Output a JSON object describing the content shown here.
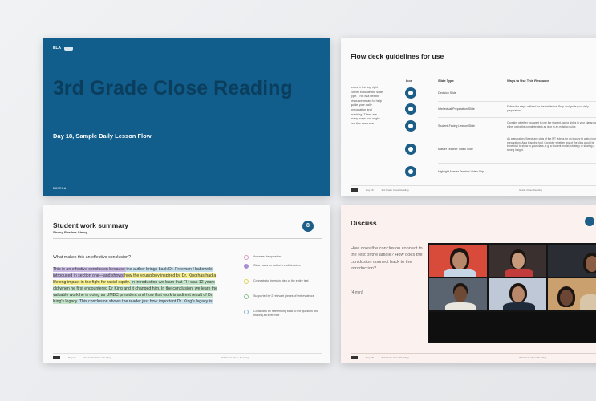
{
  "slide1": {
    "logo_text": "ELA",
    "title": "3rd Grade Close Reading",
    "subtitle": "Day 18, Sample Daily Lesson Flow",
    "footer": "EUREKA"
  },
  "slide2": {
    "title": "Flow deck guidelines for use",
    "intro": "Icons in the top right corner indicate the slide type. This is a flexible resource meant to help guide your daily preparation and teaching. There are many ways you might use this resource.",
    "headers": {
      "icon": "Icon",
      "slide_type": "Slide Type",
      "ways": "Ways to Use This Resource"
    },
    "rows": [
      {
        "type": "Decision Slide",
        "use": ""
      },
      {
        "type": "Intellectual Preparation Slide",
        "use": "Follow the steps outlined for the Intellectual Prep and guide your daily preparation."
      },
      {
        "type": "Student-Facing Lesson Slide",
        "use": "Consider whether you want to use the student-facing slides in your classroom, either using the complete deck as is or in an existing guide."
      },
      {
        "type": "Master Teacher Video Slide",
        "use": "As preparation: Select any clips of the MT videos for an inquiry to watch in your preparation. As a teaching tool: Consider whether any of the clips would be beneficial to show to your class, e.g. a student model, strategy or sharing a strong insight."
      },
      {
        "type": "Highlight Master Teacher Video Clip",
        "use": ""
      }
    ],
    "footer": {
      "a": "Day 18",
      "b": "3rd Grade Close Reading",
      "c": "Grade Close Reading"
    }
  },
  "slide3": {
    "title": "Student work summary",
    "subtitle": "Strong Readers Stamp",
    "badge": "8",
    "question": "What makes this an effective conclusion?",
    "essay": [
      {
        "text": "This is an effective conclusion because ",
        "hl": "purple"
      },
      {
        "text": "the author brings back Dr. Freeman Hrabowski",
        "hl": "blue"
      },
      {
        "text": " introduced in section one—and shows ",
        "hl": "purple"
      },
      {
        "text": "how the young boy inspired by Dr. King has had a lifelong impact in the fight for racial equity.",
        "hl": "yellow"
      },
      {
        "text": " In introduction we learn that FH was 12 years old when he first encountered Dr King and it changed him. In the conclusion, we learn the valuable work he is doing as UMBC president and how that work is a direct result of Dr. King's legacy.",
        "hl": "green"
      },
      {
        "text": " This conclusion shows the reader just how important Dr. King's legacy is.",
        "hl": "blue"
      }
    ],
    "criteria": [
      {
        "label": "Answers the question",
        "color": "#d69ac1"
      },
      {
        "label": "Clear focus on author's end/structure",
        "color": "#a98fd2"
      },
      {
        "label": "Connects to the main idea of the entire text",
        "color": "#e3cf45"
      },
      {
        "label": "Supported by 2 relevant pieces of text evidence",
        "color": "#86c08c"
      },
      {
        "label": "Concludes by referencing back to the question and making an inference",
        "color": "#86b9d2"
      }
    ],
    "footer": {
      "a": "Day 18",
      "b": "3rd Grade Close Reading",
      "c": "3rd Grade Close Reading"
    }
  },
  "slide4": {
    "title": "Discuss",
    "prompt": "How does the conclusion connect to the rest of the article? How does the conclusion connect back to the introduction?",
    "minutes": "(4 min)",
    "footer": {
      "a": "Day 18",
      "b": "3rd Grade Close Reading",
      "c": "3rd Grade Close Reading"
    }
  },
  "colors": {
    "title_slide_bg": "#115d8b",
    "title_text": "#0b3d5c",
    "icon_blue": "#1c5e88",
    "discuss_bg": "#fbf1ee"
  }
}
